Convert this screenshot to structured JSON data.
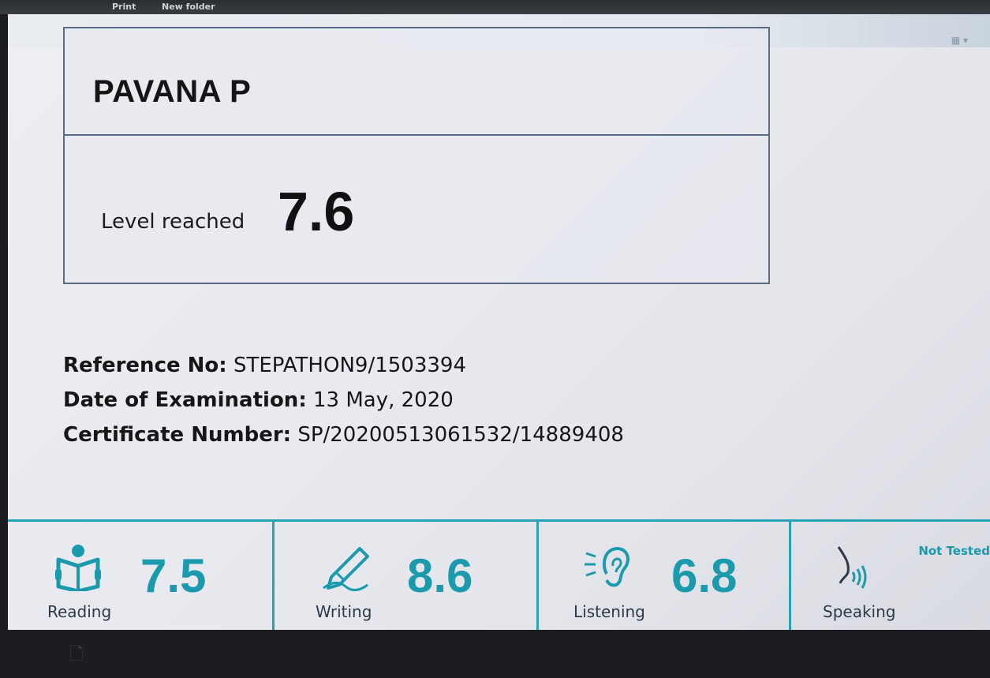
{
  "topbar": {
    "items": [
      "Print",
      "New folder"
    ]
  },
  "result": {
    "name": "PAVANA P",
    "level_label": "Level reached",
    "level_value": "7.6"
  },
  "info": {
    "reference_label": "Reference No:",
    "reference_value": "STEPATHON9/1503394",
    "date_label": "Date of Examination:",
    "date_value": "13 May, 2020",
    "certificate_label": "Certificate Number:",
    "certificate_value": "SP/20200513061532/14889408"
  },
  "skills": [
    {
      "label": "Reading",
      "score": "7.5",
      "icon": "book-reader-icon"
    },
    {
      "label": "Writing",
      "score": "8.6",
      "icon": "pen-writing-icon"
    },
    {
      "label": "Listening",
      "score": "6.8",
      "icon": "ear-listening-icon"
    },
    {
      "label": "Speaking",
      "score": "",
      "note": "Not Tested",
      "icon": "speaking-icon"
    }
  ],
  "colors": {
    "accent": "#1b9aae",
    "border": "#5a6b83",
    "text": "#161616"
  }
}
